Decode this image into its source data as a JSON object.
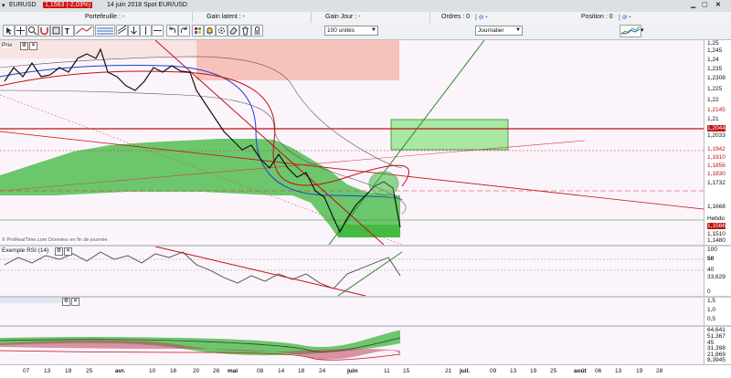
{
  "titlebar": {
    "instrument": "EURUSD",
    "price": "1,1563 (-2,03%)",
    "info": "14 juin 2018 Spot EUR/USD"
  },
  "infobar": {
    "portefeuille": "Portefeuille : -",
    "gain_latent": "Gain latent : -",
    "gain_jour": "Gain Jour : -",
    "ordres": "Ordres : 0",
    "position": "Position : 0"
  },
  "toolbar": {
    "quantity": "100 unités",
    "period": "Journalier"
  },
  "main_pane": {
    "label": "Prix",
    "source": "© ProRealTime.com Données en fin de journée"
  },
  "price_axis": {
    "ticks": [
      "1,25",
      "1,245",
      "1,24",
      "1,235",
      "1,2308",
      "1,225",
      "1,22",
      "1,2145",
      "1,21",
      "1,2044",
      "1,2033",
      "1,1942",
      "1,1910",
      "1,1856",
      "1,1830",
      "1,1732",
      "1,1668",
      "1,1566",
      "1,1510",
      "1,1480"
    ],
    "hebdo": "Hebdo"
  },
  "rsi_pane": {
    "label": "Exemple RSI (14)",
    "ticks": [
      "100",
      "50",
      "40",
      "33,629",
      "0"
    ]
  },
  "macd_pane": {
    "ticks": [
      "1,5",
      "1,0",
      "0,5"
    ]
  },
  "vol_pane": {
    "ticks": [
      "64,641",
      "51,367",
      "45",
      "31,398",
      "21,869",
      "8,3945"
    ]
  },
  "xaxis": {
    "labels": [
      "07",
      "13",
      "19",
      "25",
      "avr.",
      "10",
      "16",
      "20",
      "26",
      "mai",
      "08",
      "14",
      "18",
      "24",
      "juin",
      "11",
      "15",
      "21",
      "juil.",
      "09",
      "13",
      "19",
      "25",
      "août",
      "06",
      "13",
      "19",
      "28"
    ]
  },
  "colors": {
    "bearish": "#d01010",
    "cloud": "#3cb83c",
    "background": "#fbf4fb"
  }
}
